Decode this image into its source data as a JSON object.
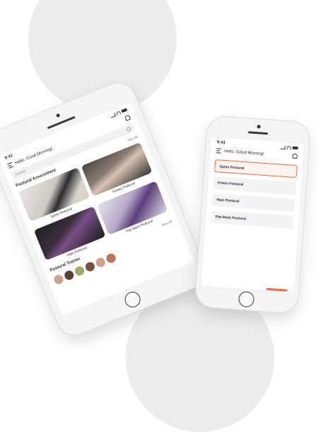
{
  "status": {
    "time": "9:41"
  },
  "phone1": {
    "greeting": "Hello, Good Morning!",
    "search_placeholder": "Search",
    "section_assessment": "Postural Assessment",
    "see_all": "See All",
    "cards": [
      {
        "label": "Spine Postural"
      },
      {
        "label": "Knees Postural"
      },
      {
        "label": "Hips Postural"
      },
      {
        "label": "Flat Back Postural"
      }
    ],
    "section_trainer": "Postural Trainer",
    "see_all_trainer": "See All",
    "trainer_count": 6
  },
  "phone2": {
    "greeting": "Hello, Good Morning!",
    "items": [
      {
        "label": "Spine Postural",
        "active": true
      },
      {
        "label": "Knees Postural",
        "active": false
      },
      {
        "label": "Hips Postural",
        "active": false
      },
      {
        "label": "Flat Back Postural",
        "active": false
      }
    ]
  },
  "colors": {
    "accent": "#ef6a3a",
    "blob": "#ececec"
  },
  "icons": [
    "menu-icon",
    "bell-icon",
    "search-icon",
    "signal-icon",
    "wifi-icon",
    "battery-icon"
  ]
}
